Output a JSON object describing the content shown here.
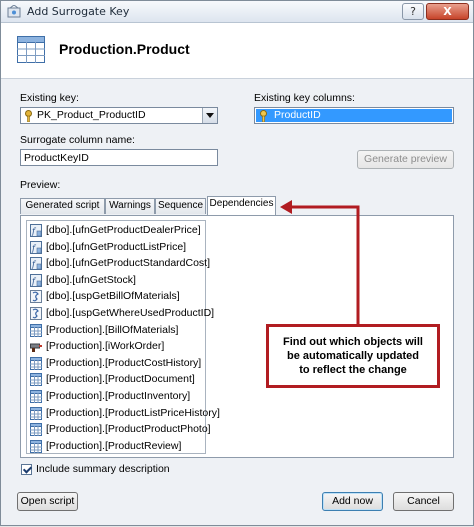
{
  "window": {
    "title": "Add Surrogate Key",
    "help_label": "?",
    "close_label": "X"
  },
  "header": {
    "title": "Production.Product"
  },
  "existing_key": {
    "label": "Existing key:",
    "value": "PK_Product_ProductID"
  },
  "existing_key_columns": {
    "label": "Existing key columns:",
    "items": [
      "ProductID"
    ]
  },
  "surrogate": {
    "label": "Surrogate column name:",
    "value": "ProductKeyID"
  },
  "buttons": {
    "generate_preview": "Generate preview",
    "open_script": "Open script",
    "add_now": "Add now",
    "cancel": "Cancel"
  },
  "preview": {
    "label": "Preview:"
  },
  "tabs": [
    "Generated script",
    "Warnings",
    "Sequence",
    "Dependencies"
  ],
  "active_tab": "Dependencies",
  "dependencies": [
    {
      "name": "[dbo].[ufnGetProductDealerPrice]",
      "icon": "function-icon"
    },
    {
      "name": "[dbo].[ufnGetProductListPrice]",
      "icon": "function-icon"
    },
    {
      "name": "[dbo].[ufnGetProductStandardCost]",
      "icon": "function-icon"
    },
    {
      "name": "[dbo].[ufnGetStock]",
      "icon": "function-icon"
    },
    {
      "name": "[dbo].[uspGetBillOfMaterials]",
      "icon": "procedure-icon"
    },
    {
      "name": "[dbo].[uspGetWhereUsedProductID]",
      "icon": "procedure-icon"
    },
    {
      "name": "[Production].[BillOfMaterials]",
      "icon": "table-icon"
    },
    {
      "name": "[Production].[iWorkOrder]",
      "icon": "trigger-icon"
    },
    {
      "name": "[Production].[ProductCostHistory]",
      "icon": "table-icon"
    },
    {
      "name": "[Production].[ProductDocument]",
      "icon": "table-icon"
    },
    {
      "name": "[Production].[ProductInventory]",
      "icon": "table-icon"
    },
    {
      "name": "[Production].[ProductListPriceHistory]",
      "icon": "table-icon"
    },
    {
      "name": "[Production].[ProductProductPhoto]",
      "icon": "table-icon"
    },
    {
      "name": "[Production].[ProductReview]",
      "icon": "table-icon"
    }
  ],
  "callout": {
    "lines": [
      "Find out which objects will",
      "be automatically updated",
      "to reflect the change"
    ]
  },
  "include_summary": {
    "label": "Include summary description",
    "checked": true
  },
  "colors": {
    "callout_border": "#b11c21",
    "selection": "#3399ff"
  }
}
